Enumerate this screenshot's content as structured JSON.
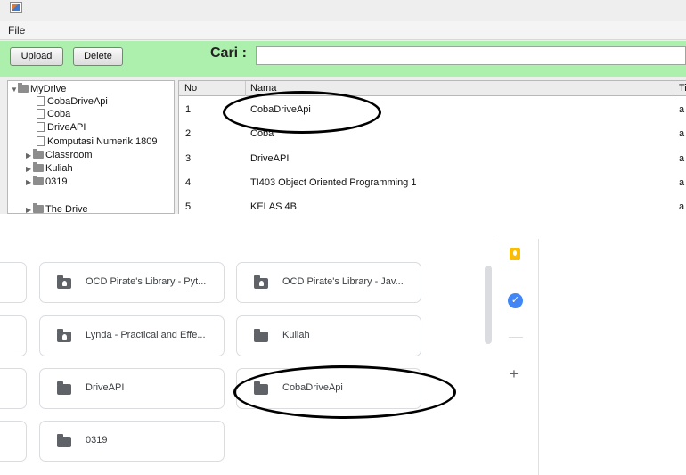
{
  "app": {
    "menu": {
      "file": "File"
    },
    "toolbar": {
      "upload": "Upload",
      "delete": "Delete",
      "search_label": "Cari :"
    },
    "tree": {
      "root": "MyDrive",
      "files": [
        "CobaDriveApi",
        "Coba",
        "DriveAPI",
        "Komputasi Numerik 1809"
      ],
      "folders": [
        "Classroom",
        "Kuliah",
        "0319",
        "The Drive"
      ]
    },
    "table": {
      "columns": [
        "No",
        "Nama",
        "Ti"
      ],
      "rows": [
        {
          "no": "1",
          "nama": "CobaDriveApi",
          "ti": "a"
        },
        {
          "no": "2",
          "nama": "Coba",
          "ti": "a"
        },
        {
          "no": "3",
          "nama": "DriveAPI",
          "ti": "a"
        },
        {
          "no": "4",
          "nama": "TI403 Object Oriented Programming 1",
          "ti": "a"
        },
        {
          "no": "5",
          "nama": "KELAS 4B",
          "ti": "a"
        }
      ]
    }
  },
  "drive": {
    "folders": [
      {
        "name": "OCD Pirate's Library - Pyt...",
        "icon": "shared-folder-icon"
      },
      {
        "name": "OCD Pirate's Library - Jav...",
        "icon": "shared-folder-icon"
      },
      {
        "name": "Lynda - Practical and Effe...",
        "icon": "shared-folder-icon"
      },
      {
        "name": "Kuliah",
        "icon": "folder-icon"
      },
      {
        "name": "DriveAPI",
        "icon": "folder-icon"
      },
      {
        "name": "CobaDriveApi",
        "icon": "folder-icon"
      },
      {
        "name": "0319",
        "icon": "folder-icon"
      }
    ],
    "side_panel": {
      "tasks_glyph": "✓",
      "add_glyph": "+"
    }
  },
  "colors": {
    "toolbar_bg": "#adf0ae",
    "keep": "#fbbc04",
    "tasks": "#4285f4",
    "card_border": "#dadce0"
  }
}
